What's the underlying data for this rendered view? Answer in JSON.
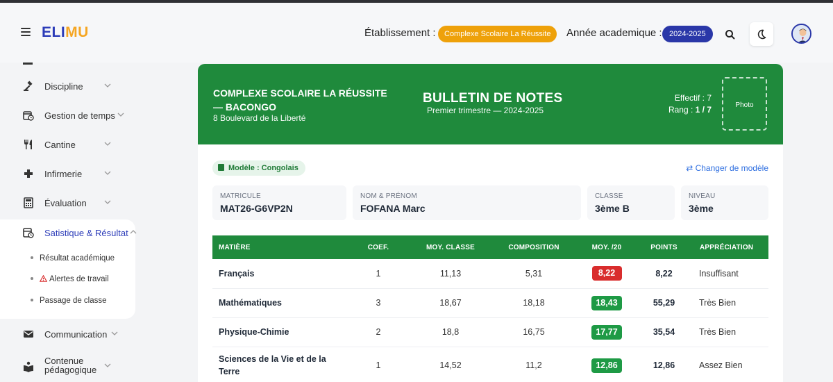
{
  "app": {
    "logo_part1": "ELI",
    "logo_part2": "MU",
    "accent": "#2b3bb8",
    "accent2": "#f5a623"
  },
  "header": {
    "etab_label": "Établissement :",
    "etab_value": "Complexe Scolaire La Réussite",
    "annee_label": "Année academique :",
    "annee_value": "2024-2025",
    "search_icon": "search-icon",
    "theme_icon": "moon-icon",
    "avatar_icon": "user-avatar"
  },
  "sidebar": {
    "items": [
      {
        "label": "Discipline",
        "icon": "gavel-icon"
      },
      {
        "label": "Gestion de temps",
        "icon": "calendar-clock-icon"
      },
      {
        "label": "Cantine",
        "icon": "cutlery-icon"
      },
      {
        "label": "Infirmerie",
        "icon": "plus-icon"
      },
      {
        "label": "Évaluation",
        "icon": "calculator-icon"
      },
      {
        "label": "Satistique & Résultat",
        "icon": "stats-icon"
      },
      {
        "label": "Communication",
        "icon": "mail-icon"
      },
      {
        "label": "Contenue pédagogique",
        "icon": "reader-icon"
      }
    ],
    "subitems": [
      {
        "label": "Résultat académique"
      },
      {
        "label": "Alertes de travail",
        "icon": "warning-icon"
      },
      {
        "label": "Passage de classe"
      }
    ]
  },
  "bulletin": {
    "school_name": "COMPLEXE SCOLAIRE LA RÉUSSITE — BACONGO",
    "school_address": "8 Boulevard de la Liberté",
    "title": "BULLETIN DE NOTES",
    "subtitle": "Premier trimestre — 2024-2025",
    "effectif": "Effectif : 7",
    "rang_label": "Rang : ",
    "rang_value": "1 / 7",
    "photo_label": "Photo",
    "model_badge": "Modèle : Congolais",
    "change_model": "⇄ Changer de modèle",
    "info": [
      {
        "label": "MATRICULE",
        "value": "MAT26-G6VP2N"
      },
      {
        "label": "NOM & PRÉNOM",
        "value": "FOFANA Marc"
      },
      {
        "label": "CLASSE",
        "value": "3ème B"
      },
      {
        "label": "NIVEAU",
        "value": "3ème"
      }
    ],
    "table": {
      "headers": [
        "MATIÈRE",
        "COEF.",
        "MOY. CLASSE",
        "COMPOSITION",
        "MOY. /20",
        "POINTS",
        "APPRÉCIATION"
      ],
      "rows": [
        {
          "matiere": "Français",
          "coef": "1",
          "moy_classe": "11,13",
          "composition": "5,31",
          "moy20": "8,22",
          "points": "8,22",
          "appreciation": "Insuffisant",
          "status": "low"
        },
        {
          "matiere": "Mathématiques",
          "coef": "3",
          "moy_classe": "18,67",
          "composition": "18,18",
          "moy20": "18,43",
          "points": "55,29",
          "appreciation": "Très Bien",
          "status": "good"
        },
        {
          "matiere": "Physique-Chimie",
          "coef": "2",
          "moy_classe": "18,8",
          "composition": "16,75",
          "moy20": "17,77",
          "points": "35,54",
          "appreciation": "Très Bien",
          "status": "good"
        },
        {
          "matiere": "Sciences de la Vie et de la Terre",
          "coef": "1",
          "moy_classe": "14,52",
          "composition": "11,2",
          "moy20": "12,86",
          "points": "12,86",
          "appreciation": "Assez Bien",
          "status": "good"
        }
      ]
    },
    "colors": {
      "header_green": "#1f8a3c",
      "pill_low": "#d92d2d",
      "pill_good": "#1e9a45"
    }
  }
}
